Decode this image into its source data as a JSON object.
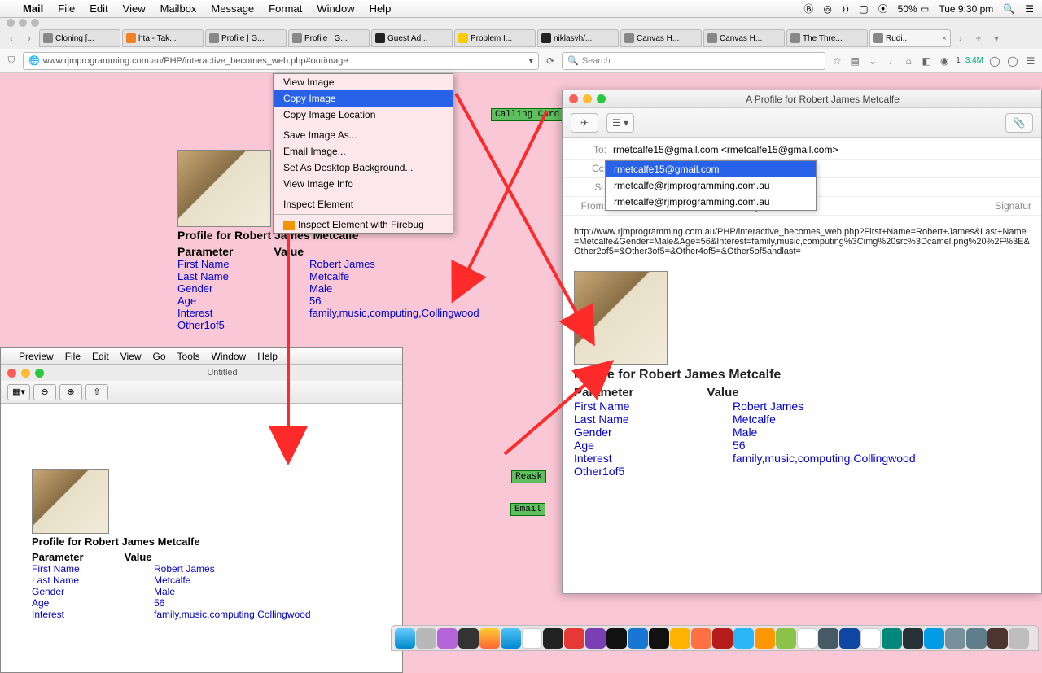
{
  "menubar": {
    "app": "Mail",
    "items": [
      "File",
      "Edit",
      "View",
      "Mailbox",
      "Message",
      "Format",
      "Window",
      "Help"
    ],
    "battery": "50%",
    "clock": "Tue 9:30 pm"
  },
  "firefox": {
    "tabs": [
      "Cloning [...",
      "hta - Tak...",
      "Profile | G...",
      "Profile | G...",
      "Guest Ad...",
      "Problem I...",
      "niklasvh/...",
      "Canvas H...",
      "Canvas H...",
      "The Thre...",
      "Rudi..."
    ],
    "url": "www.rjmprogramming.com.au/PHP/interactive_becomes_web.php#ourimage",
    "search_placeholder": "Search",
    "counter1": "1",
    "counter2": "3.4M"
  },
  "context_menu": {
    "items": [
      "View Image",
      "Copy Image",
      "Copy Image Location",
      "Save Image As...",
      "Email Image...",
      "Set As Desktop Background...",
      "View Image Info",
      "Inspect Element",
      "Inspect Element with Firebug"
    ],
    "selected": 1
  },
  "buttons": {
    "calling": "Calling Card",
    "reask": "Reask",
    "email": "Email"
  },
  "profile": {
    "title": "Profile for Robert James Metcalfe",
    "head_param": "Parameter",
    "head_value": "Value",
    "rows": [
      {
        "k": "First Name",
        "v": "Robert James"
      },
      {
        "k": "Last Name",
        "v": "Metcalfe"
      },
      {
        "k": "Gender",
        "v": "Male"
      },
      {
        "k": "Age",
        "v": "56"
      },
      {
        "k": "Interest",
        "v": "family,music,computing,Collingwood"
      },
      {
        "k": "Other1of5",
        "v": ""
      }
    ]
  },
  "preview": {
    "app": "Preview",
    "menu": [
      "File",
      "Edit",
      "View",
      "Go",
      "Tools",
      "Window",
      "Help"
    ],
    "title": "Untitled"
  },
  "mail": {
    "title": "A Profile for Robert James Metcalfe",
    "to_label": "To:",
    "to_value": "rmetcalfe15@gmail.com <rmetcalfe15@gmail.com>",
    "cc_label": "Cc:",
    "sub_label": "Su",
    "from_label": "From:",
    "from_value": "Robert Metcalfe – rmetcalfe15@gmail.com",
    "sig": "Signatur",
    "autocomplete": [
      "rmetcalfe15@gmail.com",
      "rmetcalfe@rjmprogramming.com.au",
      "rmetcalfe@rjmprogramming.com.au"
    ],
    "body_url": "http://www.rjmprogramming.com.au/PHP/interactive_becomes_web.php?First+Name=Robert+James&Last+Name=Metcalfe&Gender=Male&Age=56&Interest=family,music,computing%3Cimg%20src%3Dcamel.png%20%2F%3E&Other2of5=&Other3of5=&Other4of5=&Other5of5andlast="
  }
}
